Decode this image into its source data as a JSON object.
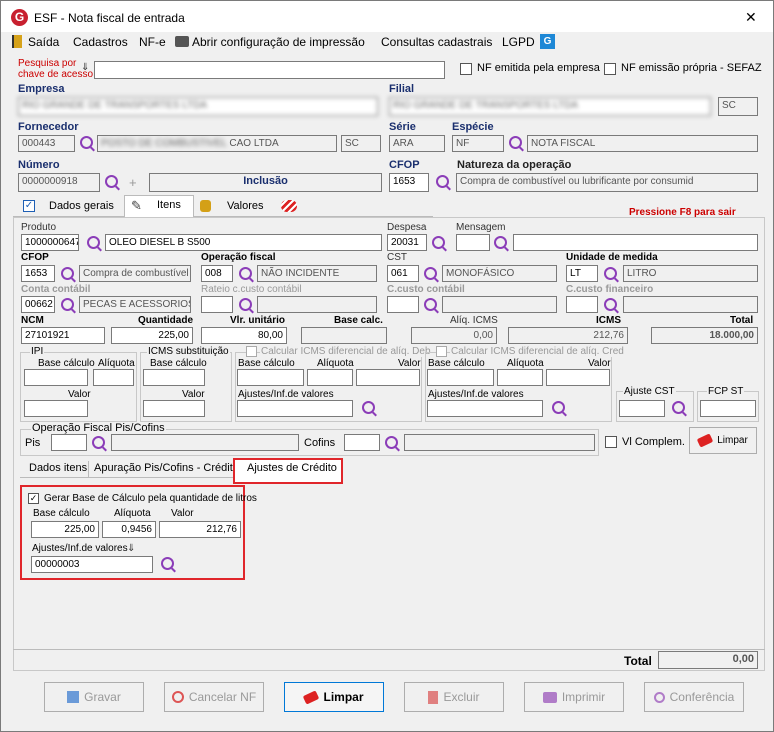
{
  "window": {
    "title": "ESF - Nota fiscal de entrada",
    "close": "✕"
  },
  "menu": {
    "saida": "Saída",
    "cadastros": "Cadastros",
    "nfe": "NF-e",
    "abrir": "Abrir configuração de impressão",
    "consultas": "Consultas cadastrais",
    "lgpd": "LGPD"
  },
  "search": {
    "label1": "Pesquisa por",
    "label2": "chave de acesso",
    "value": "",
    "nf_empresa": "NF emitida pela empresa",
    "nf_propria": "NF emissão própria - SEFAZ"
  },
  "empresa": {
    "label": "Empresa",
    "value": "RIO GRANDE DE TRANSPORTES LTDA"
  },
  "filial": {
    "label": "Filial",
    "value": "RIO GRANDE DE TRANSPORTES LTDA",
    "uf": "SC"
  },
  "fornecedor": {
    "label": "Fornecedor",
    "code": "000443",
    "name_hidden": "POSTO DE COMBUSTIVEL",
    "name_visible": "CAO LTDA",
    "uf": "SC"
  },
  "serie": {
    "label": "Série",
    "value": "ARA"
  },
  "especie": {
    "label": "Espécie",
    "code": "NF",
    "desc": "NOTA FISCAL"
  },
  "numero": {
    "label": "Número",
    "value": "0000000918",
    "status": "Inclusão"
  },
  "cfop_head": {
    "label": "CFOP",
    "value": "1653"
  },
  "natureza": {
    "label": "Natureza da operação",
    "value": "Compra de combustível ou lubrificante por consumid"
  },
  "tabs": {
    "dados_gerais": "Dados gerais",
    "itens": "Itens",
    "valores": "Valores"
  },
  "hint": "Pressione F8 para sair",
  "item": {
    "produto_label": "Produto",
    "produto_code": "1000000647",
    "produto_desc": "OLEO DIESEL B S500",
    "despesa_label": "Despesa",
    "despesa_code": "20031",
    "mensagem_label": "Mensagem",
    "cfop_label": "CFOP",
    "cfop_code": "1653",
    "cfop_desc": "Compra de combustível o",
    "opfiscal_label": "Operação fiscal",
    "opfiscal_code": "008",
    "opfiscal_desc": "NÃO INCIDENTE",
    "cst_label": "CST",
    "cst_code": "061",
    "cst_desc": "MONOFÁSICO",
    "un_label": "Unidade de medida",
    "un_code": "LT",
    "un_desc": "LITRO",
    "conta_label": "Conta contábil",
    "conta_code": "00662",
    "conta_desc": "PECAS E ACESSORIOS",
    "rateio_label": "Rateio c.custo contábil",
    "ccusto_label": "C.custo contábil",
    "ccfin_label": "C.custo financeiro",
    "ncm_label": "NCM",
    "ncm": "27101921",
    "qtd_label": "Quantidade",
    "qtd": "225,00",
    "vu_label": "Vlr. unitário",
    "vu": "80,00",
    "bc_label": "Base calc.",
    "aliq_label": "Alíq. ICMS",
    "aliq": "0,00",
    "icms_label": "ICMS",
    "icms": "212,76",
    "total_label": "Total",
    "total": "18.000,00"
  },
  "ipi": {
    "title": "IPI",
    "base": "Base cálculo",
    "aliq": "Alíquota",
    "valor": "Valor"
  },
  "icmsst": {
    "title": "ICMS substituição",
    "base": "Base cálculo",
    "valor": "Valor"
  },
  "dif1": {
    "title": "Calcular ICMS diferencial de alíq. Deb",
    "base": "Base cálculo",
    "aliq": "Alíquota",
    "valor": "Valor",
    "aj": "Ajustes/Inf.de valores"
  },
  "dif2": {
    "title": "Calcular ICMS diferencial de alíq. Cred",
    "base": "Base cálculo",
    "aliq": "Alíquota",
    "valor": "Valor",
    "aj": "Ajustes/Inf.de valores"
  },
  "ajcst": "Ajuste CST",
  "fcpst": "FCP ST",
  "pis": {
    "title": "Operação Fiscal Pis/Cofins",
    "pis": "Pis",
    "cofins": "Cofins",
    "vl": "Vl Complem.",
    "limpar": "Limpar"
  },
  "subtabs": {
    "dados": "Dados itens",
    "apuracao": "Apuração Pis/Cofins - Crédito",
    "ajustes": "Ajustes de Crédito"
  },
  "credito": {
    "gerar": "Gerar Base de Cálculo pela quantidade de litros",
    "base_label": "Base cálculo",
    "base": "225,00",
    "aliq_label": "Alíquota",
    "aliq": "0,9456",
    "valor_label": "Valor",
    "valor": "212,76",
    "aj_label": "Ajustes/Inf.de valores",
    "aj": "00000003"
  },
  "footer": {
    "total_label": "Total",
    "total": "0,00"
  },
  "buttons": {
    "gravar": "Gravar",
    "cancelar": "Cancelar NF",
    "limpar": "Limpar",
    "excluir": "Excluir",
    "imprimir": "Imprimir",
    "conferencia": "Conferência"
  }
}
